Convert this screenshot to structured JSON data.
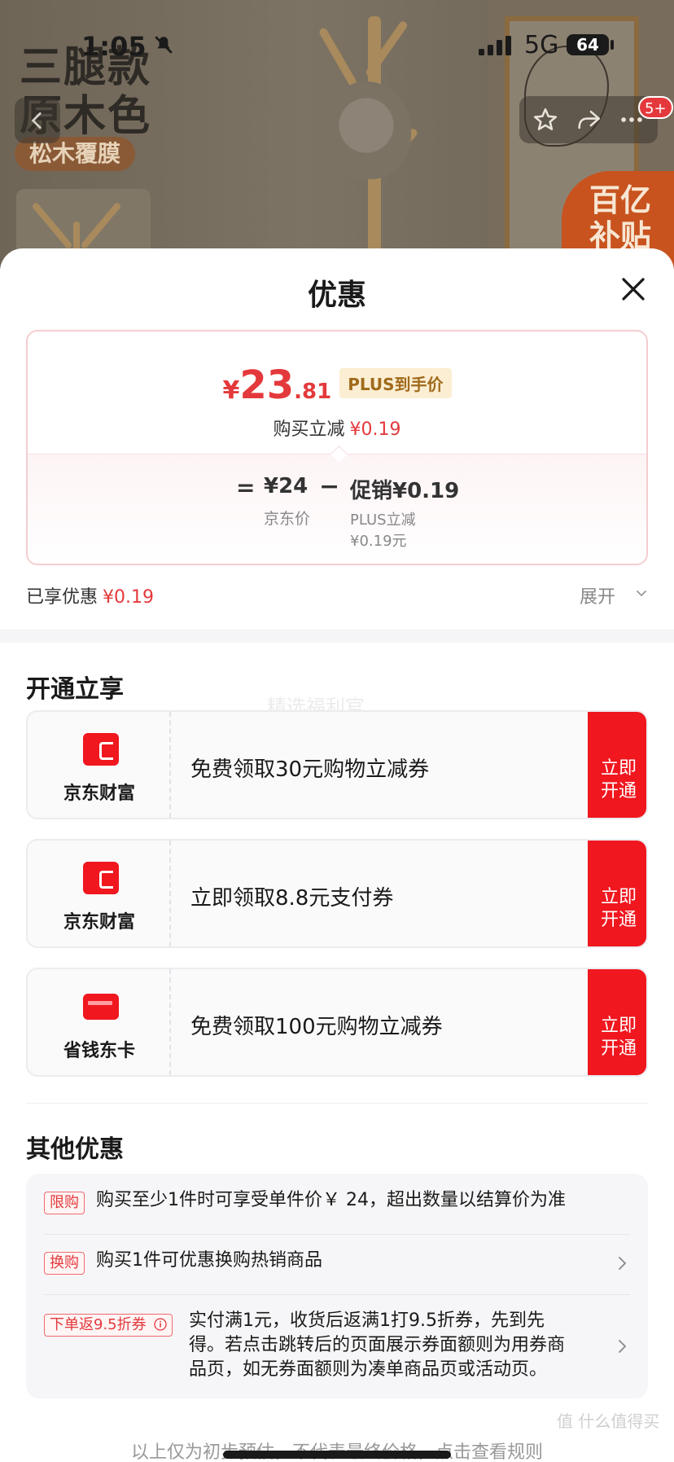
{
  "status_bar": {
    "time": "1:05",
    "network": "5G",
    "battery": "64"
  },
  "product_bg": {
    "headline_1": "三腿款",
    "headline_2": "原木色",
    "material_tag": "松木覆膜",
    "subsidy_badge_1": "百亿",
    "subsidy_badge_2": "补贴",
    "notification_badge": "5+"
  },
  "sheet": {
    "title": "优惠",
    "price": {
      "currency": "¥",
      "integer": "23",
      "decimal": ".81",
      "plus_tag": "PLUS到手价",
      "instant_label": "购买立减",
      "instant_value": "¥0.19"
    },
    "calc": {
      "equals": "=",
      "jd_price": "¥24",
      "jd_label": "京东价",
      "minus": "−",
      "promo": "促销¥0.19",
      "promo_sub_1": "PLUS立减",
      "promo_sub_2": "¥0.19元"
    },
    "enjoyed_label": "已享优惠",
    "enjoyed_value": "¥0.19",
    "expand_label": "展开"
  },
  "open_section": {
    "title": "开通立享",
    "watermark": "精选福利官",
    "offers": [
      {
        "brand": "京东财富",
        "icon": "wallet-icon",
        "desc": "免费领取30元购物立减券",
        "cta_1": "立即",
        "cta_2": "开通"
      },
      {
        "brand": "京东财富",
        "icon": "wallet-icon",
        "desc": "立即领取8.8元支付券",
        "cta_1": "立即",
        "cta_2": "开通"
      },
      {
        "brand": "省钱东卡",
        "icon": "card-icon",
        "desc": "免费领取100元购物立减券",
        "cta_1": "立即",
        "cta_2": "开通"
      }
    ]
  },
  "other_section": {
    "title": "其他优惠",
    "items": [
      {
        "tag": "限购",
        "text": "购买至少1件时可享受单件价￥ 24，超出数量以结算价为准"
      },
      {
        "tag": "换购",
        "text": "购买1件可优惠换购热销商品"
      },
      {
        "tag": "下单返9.5折券",
        "text_1": "实付满1元，收货后返满1打9.5折券，先到先",
        "text_2": "得。若点击跳转后的页面展示券面额则为用券商",
        "text_3": "品页，如无券面额则为凑单商品页或活动页。"
      }
    ]
  },
  "footer": {
    "note": "以上仅为初步预估，不代表最终价格，点击查看规则",
    "watermark": "值 什么值得买"
  },
  "colors": {
    "accent_red": "#e4393c",
    "cta_red": "#f0171f",
    "plus_gold": "#a06a1b"
  }
}
